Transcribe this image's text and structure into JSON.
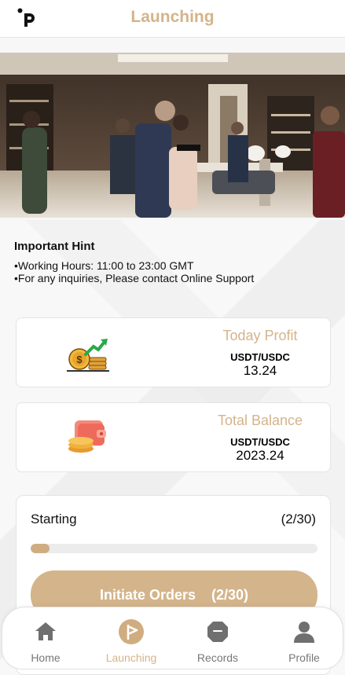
{
  "header": {
    "title": "Launching",
    "logo_icon": "p-logo-icon"
  },
  "hint": {
    "title": "Important Hint",
    "lines": [
      "Working Hours: 11:00 to 23:00 GMT",
      "For any inquiries, Please contact Online Support"
    ]
  },
  "cards": {
    "today_profit": {
      "label": "Today Profit",
      "unit": "USDT/USDC",
      "value": "13.24",
      "icon": "coins-growth-icon"
    },
    "total_balance": {
      "label": "Total Balance",
      "unit": "USDT/USDC",
      "value": "2023.24",
      "icon": "wallet-coins-icon"
    }
  },
  "progress": {
    "label": "Starting",
    "count": "(2/30)",
    "completed": 2,
    "total": 30,
    "button_label": "Initiate Orders    (2/30)"
  },
  "nav": {
    "items": [
      {
        "label": "Home",
        "icon": "home-icon"
      },
      {
        "label": "Launching",
        "icon": "flag-icon",
        "active": true
      },
      {
        "label": "Records",
        "icon": "octagon-icon"
      },
      {
        "label": "Profile",
        "icon": "user-icon"
      }
    ]
  },
  "colors": {
    "accent": "#d4b48a",
    "progress_fill": "#d0ad80",
    "nav_inactive": "#777777"
  }
}
